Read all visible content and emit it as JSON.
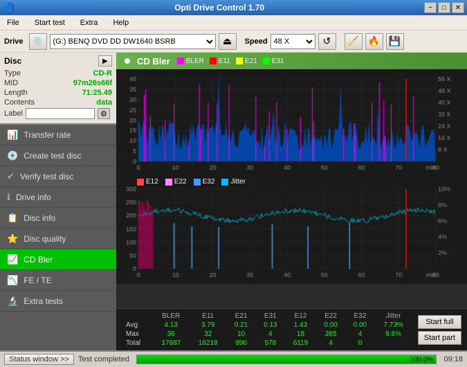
{
  "titlebar": {
    "title": "Opti Drive Control 1.70",
    "icon": "⚙",
    "minimize": "−",
    "maximize": "□",
    "close": "✕"
  },
  "menubar": {
    "items": [
      "File",
      "Start test",
      "Extra",
      "Help"
    ]
  },
  "drivebar": {
    "label": "Drive",
    "drive_value": "(G:)  BENQ DVD DD DW1640 BSRB",
    "speed_label": "Speed",
    "speed_value": "48 X"
  },
  "disc": {
    "title": "Disc",
    "type_label": "Type",
    "type_value": "CD-R",
    "mid_label": "MID",
    "mid_value": "97m26s66f",
    "length_label": "Length",
    "length_value": "71:25.49",
    "contents_label": "Contents",
    "contents_value": "data",
    "label_label": "Label",
    "label_value": ""
  },
  "sidebar": {
    "items": [
      {
        "id": "transfer-rate",
        "label": "Transfer rate",
        "icon": "📊"
      },
      {
        "id": "create-test-disc",
        "label": "Create test disc",
        "icon": "💿"
      },
      {
        "id": "verify-test-disc",
        "label": "Verify test disc",
        "icon": "✔"
      },
      {
        "id": "drive-info",
        "label": "Drive info",
        "icon": "ℹ"
      },
      {
        "id": "disc-info",
        "label": "Disc info",
        "icon": "📋"
      },
      {
        "id": "disc-quality",
        "label": "Disc quality",
        "icon": "⭐"
      },
      {
        "id": "cd-bler",
        "label": "CD Bler",
        "icon": "📈",
        "active": true
      },
      {
        "id": "fe-te",
        "label": "FE / TE",
        "icon": "📉"
      },
      {
        "id": "extra-tests",
        "label": "Extra tests",
        "icon": "🔬"
      }
    ]
  },
  "chart": {
    "title": "CD Bler",
    "top_legend": [
      {
        "label": "BLER",
        "color": "#ff00ff"
      },
      {
        "label": "E11",
        "color": "#ff0000"
      },
      {
        "label": "E21",
        "color": "#ffff00"
      },
      {
        "label": "E31",
        "color": "#00ff00"
      }
    ],
    "bottom_legend": [
      {
        "label": "E12",
        "color": "#ff4444"
      },
      {
        "label": "E22",
        "color": "#ff88ff"
      },
      {
        "label": "E32",
        "color": "#44aaff"
      },
      {
        "label": "Jitter",
        "color": "#00bbff"
      }
    ]
  },
  "stats": {
    "headers": [
      "",
      "BLER",
      "E11",
      "E21",
      "E31",
      "E12",
      "E22",
      "E32",
      "Jitter"
    ],
    "rows": [
      {
        "label": "Avg",
        "values": [
          "4.13",
          "3.79",
          "0.21",
          "0.13",
          "1.43",
          "0.00",
          "0.00",
          "7.73%"
        ]
      },
      {
        "label": "Max",
        "values": [
          "36",
          "32",
          "10",
          "4",
          "18",
          "265",
          "4",
          "9.6%"
        ]
      },
      {
        "label": "Total",
        "values": [
          "17687",
          "16219",
          "890",
          "578",
          "6119",
          "4",
          "0",
          ""
        ]
      }
    ],
    "start_full_label": "Start full",
    "start_part_label": "Start part"
  },
  "statusbar": {
    "status_window_label": "Status window >>",
    "completed_label": "Test completed",
    "progress_percent": 100,
    "time": "09:18"
  },
  "colors": {
    "accent_green": "#00c000",
    "chart_bg": "#1a1a1a",
    "grid": "#333333"
  }
}
